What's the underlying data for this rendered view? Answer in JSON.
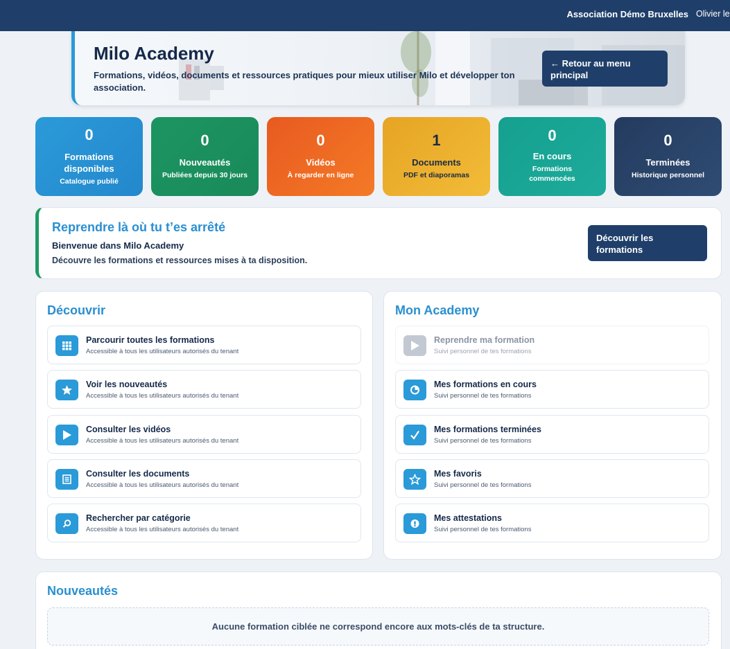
{
  "topbar": {
    "association": "Association Démo Bruxelles",
    "user": "Olivier le"
  },
  "hero": {
    "title": "Milo Academy",
    "subtitle": "Formations, vidéos, documents et ressources pratiques pour mieux utiliser Milo et développer ton association.",
    "back_button": "← Retour au menu principal"
  },
  "stats": [
    {
      "value": "0",
      "label": "Formations disponibles",
      "sub": "Catalogue publié",
      "color": "#2b9ad9"
    },
    {
      "value": "0",
      "label": "Nouveautés",
      "sub": "Publiées depuis 30 jours",
      "color": "#1c9562"
    },
    {
      "value": "0",
      "label": "Vidéos",
      "sub": "À regarder en ligne",
      "color": "#ee6a22"
    },
    {
      "value": "1",
      "label": "Documents",
      "sub": "PDF et diaporamas",
      "color": "#eeb12e"
    },
    {
      "value": "0",
      "label": "En cours",
      "sub": "Formations commencées",
      "color": "#1ba495"
    },
    {
      "value": "0",
      "label": "Terminées",
      "sub": "Historique personnel",
      "color": "#2b4468"
    }
  ],
  "resume": {
    "title": "Reprendre là où tu t’es arrêté",
    "welcome": "Bienvenue dans Milo Academy",
    "description": "Découvre les formations et ressources mises à ta disposition.",
    "button": "Découvrir les formations"
  },
  "discover": {
    "title": "Découvrir",
    "items": [
      {
        "label": "Parcourir toutes les formations",
        "sub": "Accessible à tous les utilisateurs autorisés du tenant",
        "icon": "grid-icon"
      },
      {
        "label": "Voir les nouveautés",
        "sub": "Accessible à tous les utilisateurs autorisés du tenant",
        "icon": "star-icon"
      },
      {
        "label": "Consulter les vidéos",
        "sub": "Accessible à tous les utilisateurs autorisés du tenant",
        "icon": "play-icon"
      },
      {
        "label": "Consulter les documents",
        "sub": "Accessible à tous les utilisateurs autorisés du tenant",
        "icon": "document-icon"
      },
      {
        "label": "Rechercher par catégorie",
        "sub": "Accessible à tous les utilisateurs autorisés du tenant",
        "icon": "search-icon"
      }
    ]
  },
  "academy": {
    "title": "Mon Academy",
    "items": [
      {
        "label": "Reprendre ma formation",
        "sub": "Suivi personnel de tes formations",
        "icon": "play-icon"
      },
      {
        "label": "Mes formations en cours",
        "sub": "Suivi personnel de tes formations",
        "icon": "progress-icon"
      },
      {
        "label": "Mes formations terminées",
        "sub": "Suivi personnel de tes formations",
        "icon": "check-icon"
      },
      {
        "label": "Mes favoris",
        "sub": "Suivi personnel de tes formations",
        "icon": "star-icon"
      },
      {
        "label": "Mes attestations",
        "sub": "Suivi personnel de tes formations",
        "icon": "badge-icon"
      }
    ]
  },
  "news": {
    "title": "Nouveautés",
    "empty_message": "Aucune formation ciblée ne correspond encore aux mots-clés de ta structure."
  }
}
